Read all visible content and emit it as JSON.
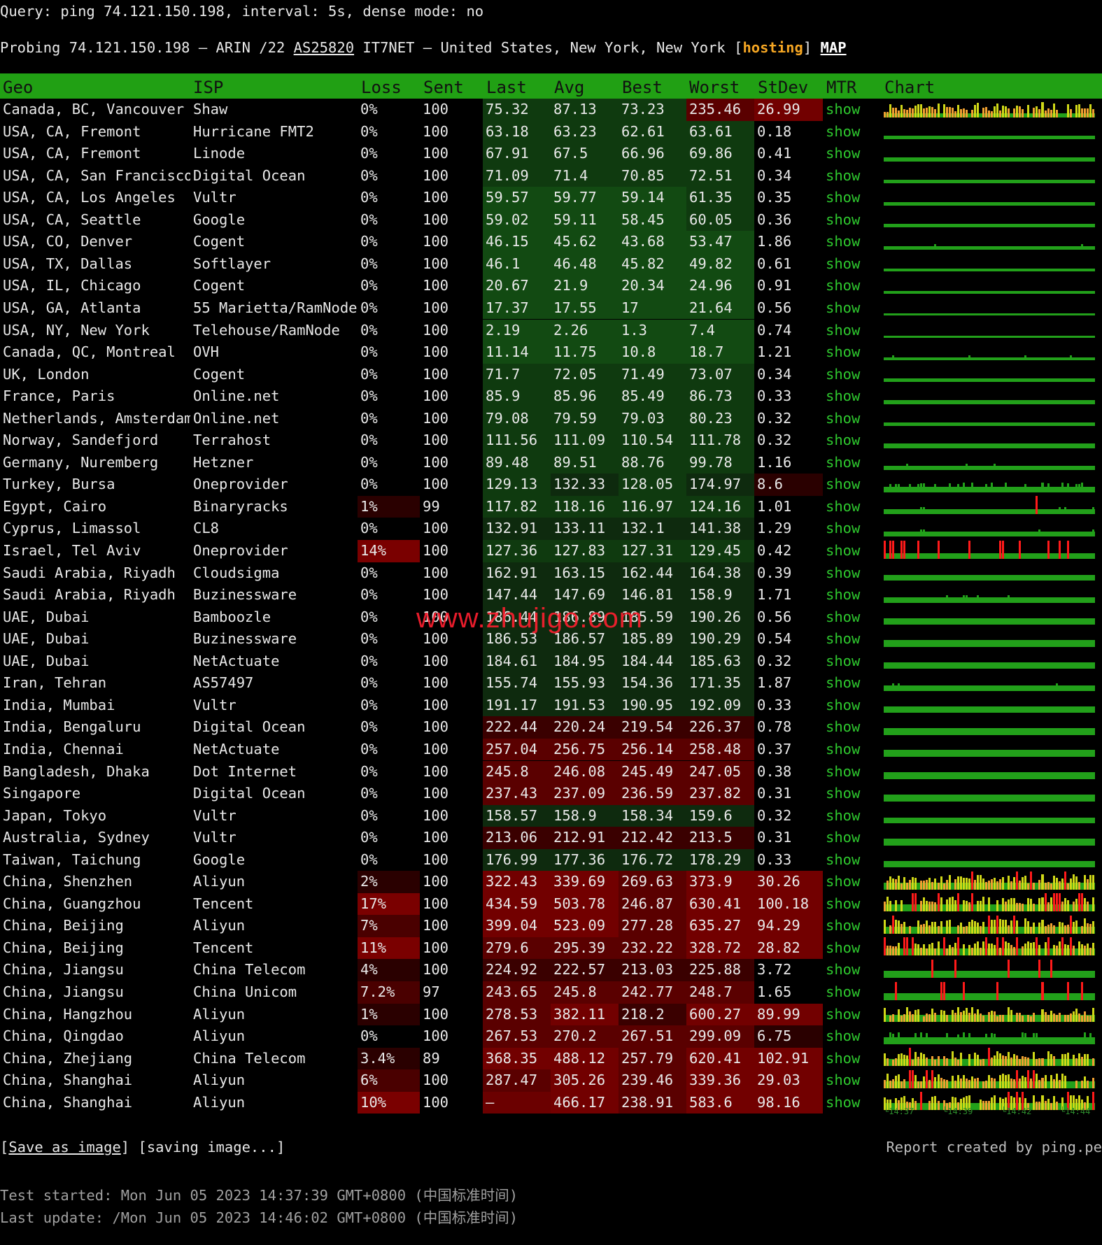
{
  "query_line": "Query: ping 74.121.150.198, interval: 5s, dense mode: no",
  "probe": {
    "prefix": "Probing 74.121.150.198 — ARIN /22 ",
    "asn": "AS25820",
    "middle": " IT7NET — United States, New York, New York [",
    "tag": "hosting",
    "close": "] ",
    "map": "MAP"
  },
  "headers": [
    "Geo",
    "ISP",
    "Loss",
    "Sent",
    "Last",
    "Avg",
    "Best",
    "Worst",
    "StDev",
    "MTR",
    "Chart"
  ],
  "show_label": "show",
  "rows": [
    {
      "geo": "Canada, BC, Vancouver",
      "isp": "Shaw",
      "loss": "0%",
      "sent": "100",
      "last": "75.32",
      "avg": "87.13",
      "best": "73.23",
      "worst": "235.46",
      "stdev": "26.99"
    },
    {
      "geo": "USA, CA, Fremont",
      "isp": "Hurricane FMT2",
      "loss": "0%",
      "sent": "100",
      "last": "63.18",
      "avg": "63.23",
      "best": "62.61",
      "worst": "63.61",
      "stdev": "0.18"
    },
    {
      "geo": "USA, CA, Fremont",
      "isp": "Linode",
      "loss": "0%",
      "sent": "100",
      "last": "67.91",
      "avg": "67.5",
      "best": "66.96",
      "worst": "69.86",
      "stdev": "0.41"
    },
    {
      "geo": "USA, CA, San Francisco",
      "isp": "Digital Ocean",
      "loss": "0%",
      "sent": "100",
      "last": "71.09",
      "avg": "71.4",
      "best": "70.85",
      "worst": "72.51",
      "stdev": "0.34"
    },
    {
      "geo": "USA, CA, Los Angeles",
      "isp": "Vultr",
      "loss": "0%",
      "sent": "100",
      "last": "59.57",
      "avg": "59.77",
      "best": "59.14",
      "worst": "61.35",
      "stdev": "0.35"
    },
    {
      "geo": "USA, CA, Seattle",
      "isp": "Google",
      "loss": "0%",
      "sent": "100",
      "last": "59.02",
      "avg": "59.11",
      "best": "58.45",
      "worst": "60.05",
      "stdev": "0.36"
    },
    {
      "geo": "USA, CO, Denver",
      "isp": "Cogent",
      "loss": "0%",
      "sent": "100",
      "last": "46.15",
      "avg": "45.62",
      "best": "43.68",
      "worst": "53.47",
      "stdev": "1.86"
    },
    {
      "geo": "USA, TX, Dallas",
      "isp": "Softlayer",
      "loss": "0%",
      "sent": "100",
      "last": "46.1",
      "avg": "46.48",
      "best": "45.82",
      "worst": "49.82",
      "stdev": "0.61"
    },
    {
      "geo": "USA, IL, Chicago",
      "isp": "Cogent",
      "loss": "0%",
      "sent": "100",
      "last": "20.67",
      "avg": "21.9",
      "best": "20.34",
      "worst": "24.96",
      "stdev": "0.91"
    },
    {
      "geo": "USA, GA, Atlanta",
      "isp": "55 Marietta/RamNode",
      "loss": "0%",
      "sent": "100",
      "last": "17.37",
      "avg": "17.55",
      "best": "17",
      "worst": "21.64",
      "stdev": "0.56"
    },
    {
      "geo": "USA, NY, New York",
      "isp": "Telehouse/RamNode",
      "loss": "0%",
      "sent": "100",
      "last": "2.19",
      "avg": "2.26",
      "best": "1.3",
      "worst": "7.4",
      "stdev": "0.74"
    },
    {
      "geo": "Canada, QC, Montreal",
      "isp": "OVH",
      "loss": "0%",
      "sent": "100",
      "last": "11.14",
      "avg": "11.75",
      "best": "10.8",
      "worst": "18.7",
      "stdev": "1.21"
    },
    {
      "geo": "UK, London",
      "isp": "Cogent",
      "loss": "0%",
      "sent": "100",
      "last": "71.7",
      "avg": "72.05",
      "best": "71.49",
      "worst": "73.07",
      "stdev": "0.34"
    },
    {
      "geo": "France, Paris",
      "isp": "Online.net",
      "loss": "0%",
      "sent": "100",
      "last": "85.9",
      "avg": "85.96",
      "best": "85.49",
      "worst": "86.73",
      "stdev": "0.33"
    },
    {
      "geo": "Netherlands, Amsterdam",
      "isp": "Online.net",
      "loss": "0%",
      "sent": "100",
      "last": "79.08",
      "avg": "79.59",
      "best": "79.03",
      "worst": "80.23",
      "stdev": "0.32"
    },
    {
      "geo": "Norway, Sandefjord",
      "isp": "Terrahost",
      "loss": "0%",
      "sent": "100",
      "last": "111.56",
      "avg": "111.09",
      "best": "110.54",
      "worst": "111.78",
      "stdev": "0.32"
    },
    {
      "geo": "Germany, Nuremberg",
      "isp": "Hetzner",
      "loss": "0%",
      "sent": "100",
      "last": "89.48",
      "avg": "89.51",
      "best": "88.76",
      "worst": "99.78",
      "stdev": "1.16"
    },
    {
      "geo": "Turkey, Bursa",
      "isp": "Oneprovider",
      "loss": "0%",
      "sent": "100",
      "last": "129.13",
      "avg": "132.33",
      "best": "128.05",
      "worst": "174.97",
      "stdev": "8.6"
    },
    {
      "geo": "Egypt, Cairo",
      "isp": "Binaryracks",
      "loss": "1%",
      "sent": "99",
      "last": "117.82",
      "avg": "118.16",
      "best": "116.97",
      "worst": "124.16",
      "stdev": "1.01"
    },
    {
      "geo": "Cyprus, Limassol",
      "isp": "CL8",
      "loss": "0%",
      "sent": "100",
      "last": "132.91",
      "avg": "133.11",
      "best": "132.1",
      "worst": "141.38",
      "stdev": "1.29"
    },
    {
      "geo": "Israel, Tel Aviv",
      "isp": "Oneprovider",
      "loss": "14%",
      "sent": "100",
      "last": "127.36",
      "avg": "127.83",
      "best": "127.31",
      "worst": "129.45",
      "stdev": "0.42"
    },
    {
      "geo": "Saudi Arabia, Riyadh",
      "isp": "Cloudsigma",
      "loss": "0%",
      "sent": "100",
      "last": "162.91",
      "avg": "163.15",
      "best": "162.44",
      "worst": "164.38",
      "stdev": "0.39"
    },
    {
      "geo": "Saudi Arabia, Riyadh",
      "isp": "Buzinessware",
      "loss": "0%",
      "sent": "100",
      "last": "147.44",
      "avg": "147.69",
      "best": "146.81",
      "worst": "158.9",
      "stdev": "1.71"
    },
    {
      "geo": "UAE, Dubai",
      "isp": "Bamboozle",
      "loss": "0%",
      "sent": "100",
      "last": "186.44",
      "avg": "186.89",
      "best": "185.59",
      "worst": "190.26",
      "stdev": "0.56"
    },
    {
      "geo": "UAE, Dubai",
      "isp": "Buzinessware",
      "loss": "0%",
      "sent": "100",
      "last": "186.53",
      "avg": "186.57",
      "best": "185.89",
      "worst": "190.29",
      "stdev": "0.54"
    },
    {
      "geo": "UAE, Dubai",
      "isp": "NetActuate",
      "loss": "0%",
      "sent": "100",
      "last": "184.61",
      "avg": "184.95",
      "best": "184.44",
      "worst": "185.63",
      "stdev": "0.32"
    },
    {
      "geo": "Iran, Tehran",
      "isp": "AS57497",
      "loss": "0%",
      "sent": "100",
      "last": "155.74",
      "avg": "155.93",
      "best": "154.36",
      "worst": "171.35",
      "stdev": "1.87"
    },
    {
      "geo": "India, Mumbai",
      "isp": "Vultr",
      "loss": "0%",
      "sent": "100",
      "last": "191.17",
      "avg": "191.53",
      "best": "190.95",
      "worst": "192.09",
      "stdev": "0.33"
    },
    {
      "geo": "India, Bengaluru",
      "isp": "Digital Ocean",
      "loss": "0%",
      "sent": "100",
      "last": "222.44",
      "avg": "220.24",
      "best": "219.54",
      "worst": "226.37",
      "stdev": "0.78"
    },
    {
      "geo": "India, Chennai",
      "isp": "NetActuate",
      "loss": "0%",
      "sent": "100",
      "last": "257.04",
      "avg": "256.75",
      "best": "256.14",
      "worst": "258.48",
      "stdev": "0.37"
    },
    {
      "geo": "Bangladesh, Dhaka",
      "isp": "Dot Internet",
      "loss": "0%",
      "sent": "100",
      "last": "245.8",
      "avg": "246.08",
      "best": "245.49",
      "worst": "247.05",
      "stdev": "0.38"
    },
    {
      "geo": "Singapore",
      "isp": "Digital Ocean",
      "loss": "0%",
      "sent": "100",
      "last": "237.43",
      "avg": "237.09",
      "best": "236.59",
      "worst": "237.82",
      "stdev": "0.31"
    },
    {
      "geo": "Japan, Tokyo",
      "isp": "Vultr",
      "loss": "0%",
      "sent": "100",
      "last": "158.57",
      "avg": "158.9",
      "best": "158.34",
      "worst": "159.6",
      "stdev": "0.32"
    },
    {
      "geo": "Australia, Sydney",
      "isp": "Vultr",
      "loss": "0%",
      "sent": "100",
      "last": "213.06",
      "avg": "212.91",
      "best": "212.42",
      "worst": "213.5",
      "stdev": "0.31"
    },
    {
      "geo": "Taiwan, Taichung",
      "isp": "Google",
      "loss": "0%",
      "sent": "100",
      "last": "176.99",
      "avg": "177.36",
      "best": "176.72",
      "worst": "178.29",
      "stdev": "0.33"
    },
    {
      "geo": "China, Shenzhen",
      "isp": "Aliyun",
      "loss": "2%",
      "sent": "100",
      "last": "322.43",
      "avg": "339.69",
      "best": "269.63",
      "worst": "373.9",
      "stdev": "30.26"
    },
    {
      "geo": "China, Guangzhou",
      "isp": "Tencent",
      "loss": "17%",
      "sent": "100",
      "last": "434.59",
      "avg": "503.78",
      "best": "246.87",
      "worst": "630.41",
      "stdev": "100.18"
    },
    {
      "geo": "China, Beijing",
      "isp": "Aliyun",
      "loss": "7%",
      "sent": "100",
      "last": "399.04",
      "avg": "523.09",
      "best": "277.28",
      "worst": "635.27",
      "stdev": "94.29"
    },
    {
      "geo": "China, Beijing",
      "isp": "Tencent",
      "loss": "11%",
      "sent": "100",
      "last": "279.6",
      "avg": "295.39",
      "best": "232.22",
      "worst": "328.72",
      "stdev": "28.82"
    },
    {
      "geo": "China, Jiangsu",
      "isp": "China Telecom",
      "loss": "4%",
      "sent": "100",
      "last": "224.92",
      "avg": "222.57",
      "best": "213.03",
      "worst": "225.88",
      "stdev": "3.72"
    },
    {
      "geo": "China, Jiangsu",
      "isp": "China Unicom",
      "loss": "7.2%",
      "sent": "97",
      "last": "243.65",
      "avg": "245.8",
      "best": "242.77",
      "worst": "248.7",
      "stdev": "1.65"
    },
    {
      "geo": "China, Hangzhou",
      "isp": "Aliyun",
      "loss": "1%",
      "sent": "100",
      "last": "278.53",
      "avg": "382.11",
      "best": "218.2",
      "worst": "600.27",
      "stdev": "89.99"
    },
    {
      "geo": "China, Qingdao",
      "isp": "Aliyun",
      "loss": "0%",
      "sent": "100",
      "last": "267.53",
      "avg": "270.2",
      "best": "267.51",
      "worst": "299.09",
      "stdev": "6.75"
    },
    {
      "geo": "China, Zhejiang",
      "isp": "China Telecom",
      "loss": "3.4%",
      "sent": "89",
      "last": "368.35",
      "avg": "488.12",
      "best": "257.79",
      "worst": "620.41",
      "stdev": "102.91"
    },
    {
      "geo": "China, Shanghai",
      "isp": "Aliyun",
      "loss": "6%",
      "sent": "100",
      "last": "287.47",
      "avg": "305.26",
      "best": "239.46",
      "worst": "339.36",
      "stdev": "29.03"
    },
    {
      "geo": "China, Shanghai",
      "isp": "Aliyun",
      "loss": "10%",
      "sent": "100",
      "last": "–",
      "avg": "466.17",
      "best": "238.91",
      "worst": "583.6",
      "stdev": "98.16"
    }
  ],
  "time_labels": [
    "└14:37",
    "└14:39",
    "└14:42",
    "└14:44"
  ],
  "save": {
    "open": "[",
    "link": "Save as image",
    "close": "] [saving image...]"
  },
  "report": "Report created by ping.pe",
  "test_started": "Test started: Mon Jun 05 2023 14:37:39 GMT+0800 (中国标准时间)",
  "last_update": "Last update: /Mon Jun 05 2023 14:46:02 GMT+0800 (中国标准时间)",
  "watermark": "www.zhujigo.com",
  "colors": {
    "header_green": "#21a014",
    "show_green": "#2ec82e",
    "hosting_orange": "#f5a623",
    "bar_green": "#22a01a",
    "loss_red": "#ff1a1a",
    "spike_yellow": "#d0d818",
    "spike_orange": "#f0a030"
  }
}
